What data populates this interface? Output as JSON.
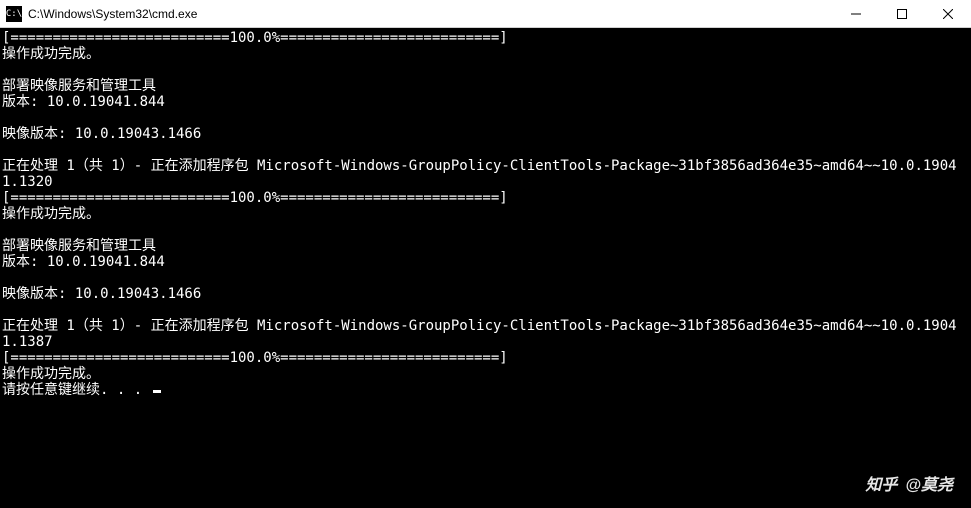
{
  "window": {
    "title": "C:\\Windows\\System32\\cmd.exe",
    "icon_label": "cmd-icon"
  },
  "console": {
    "lines": [
      "[==========================100.0%==========================]",
      "操作成功完成。",
      "",
      "部署映像服务和管理工具",
      "版本: 10.0.19041.844",
      "",
      "映像版本: 10.0.19043.1466",
      "",
      "正在处理 1（共 1）- 正在添加程序包 Microsoft-Windows-GroupPolicy-ClientTools-Package~31bf3856ad364e35~amd64~~10.0.19041.1320",
      "[==========================100.0%==========================]",
      "操作成功完成。",
      "",
      "部署映像服务和管理工具",
      "版本: 10.0.19041.844",
      "",
      "映像版本: 10.0.19043.1466",
      "",
      "正在处理 1（共 1）- 正在添加程序包 Microsoft-Windows-GroupPolicy-ClientTools-Package~31bf3856ad364e35~amd64~~10.0.19041.1387",
      "[==========================100.0%==========================]",
      "操作成功完成。",
      "请按任意键继续. . . "
    ]
  },
  "watermark": {
    "brand": "知乎",
    "author": "@莫尧"
  }
}
